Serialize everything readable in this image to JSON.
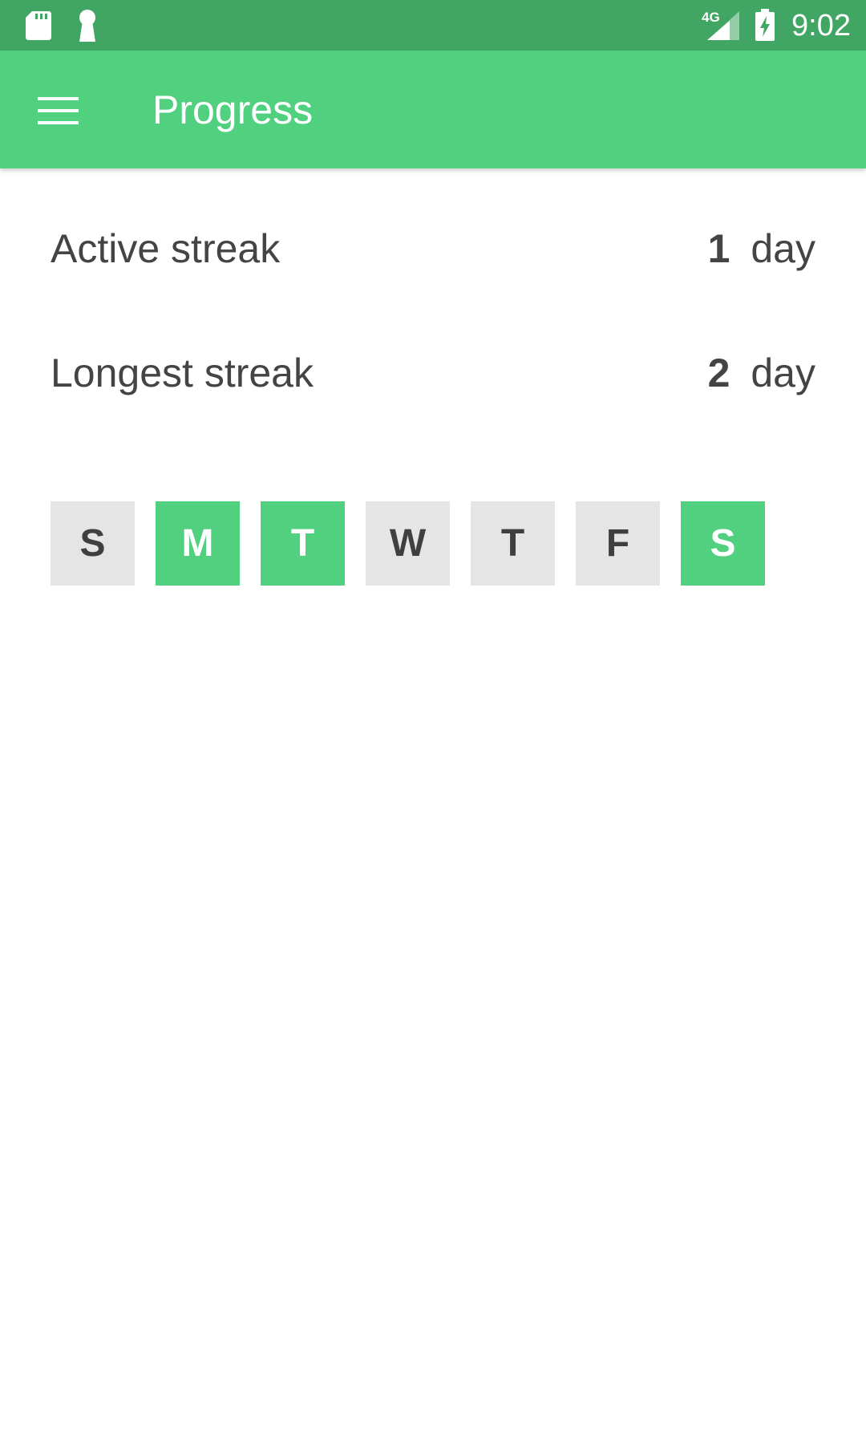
{
  "status_bar": {
    "network": "4G",
    "time": "9:02",
    "icons": [
      "sd-card-icon",
      "keyhole-icon",
      "signal-icon",
      "battery-charging-icon"
    ]
  },
  "app_bar": {
    "title": "Progress",
    "menu_icon": "hamburger-menu-icon"
  },
  "stats": {
    "active": {
      "label": "Active streak",
      "value": "1",
      "unit": "day"
    },
    "longest": {
      "label": "Longest streak",
      "value": "2",
      "unit": "day"
    }
  },
  "week": {
    "days": [
      {
        "letter": "S",
        "completed": false
      },
      {
        "letter": "M",
        "completed": true
      },
      {
        "letter": "T",
        "completed": true
      },
      {
        "letter": "W",
        "completed": false
      },
      {
        "letter": "T",
        "completed": false
      },
      {
        "letter": "F",
        "completed": false
      },
      {
        "letter": "S",
        "completed": true
      }
    ]
  },
  "colors": {
    "status_bar": "#41a563",
    "app_bar": "#51d080",
    "completed_day": "#51d080",
    "incomplete_day": "#e5e5e5",
    "text": "#444444"
  }
}
